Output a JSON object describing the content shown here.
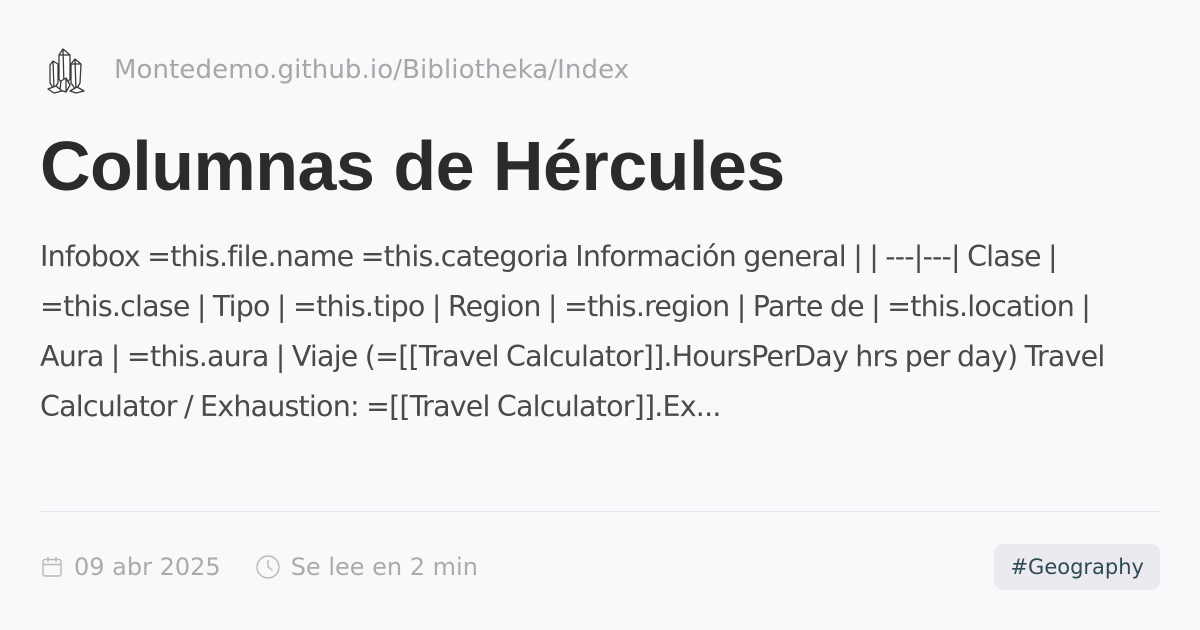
{
  "site": {
    "logo_icon": "crystal-cluster-icon",
    "path": "Montedemo.github.io/Bibliotheka/Index"
  },
  "page": {
    "title": "Columnas de Hércules",
    "excerpt": "Infobox =this.file.name =this.categoria Información general | | ---|---| Clase | =this.clase | Tipo | =this.tipo | Region | =this.region | Parte de | =this.location | Aura | =this.aura | Viaje (=[[Travel Calculator]].HoursPerDay hrs per day) Travel Calculator / Exhaustion: =[[Travel Calculator]].Ex..."
  },
  "meta": {
    "date_icon": "calendar-icon",
    "date": "09 abr 2025",
    "reading_icon": "clock-icon",
    "reading_time": "Se lee en 2 min"
  },
  "tags": [
    "#Geography"
  ],
  "colors": {
    "background": "#f9f8fa",
    "title": "#2b2b2b",
    "muted": "#a7a7aa",
    "tag_bg": "#ebebef",
    "tag_text": "#2f4a57"
  }
}
